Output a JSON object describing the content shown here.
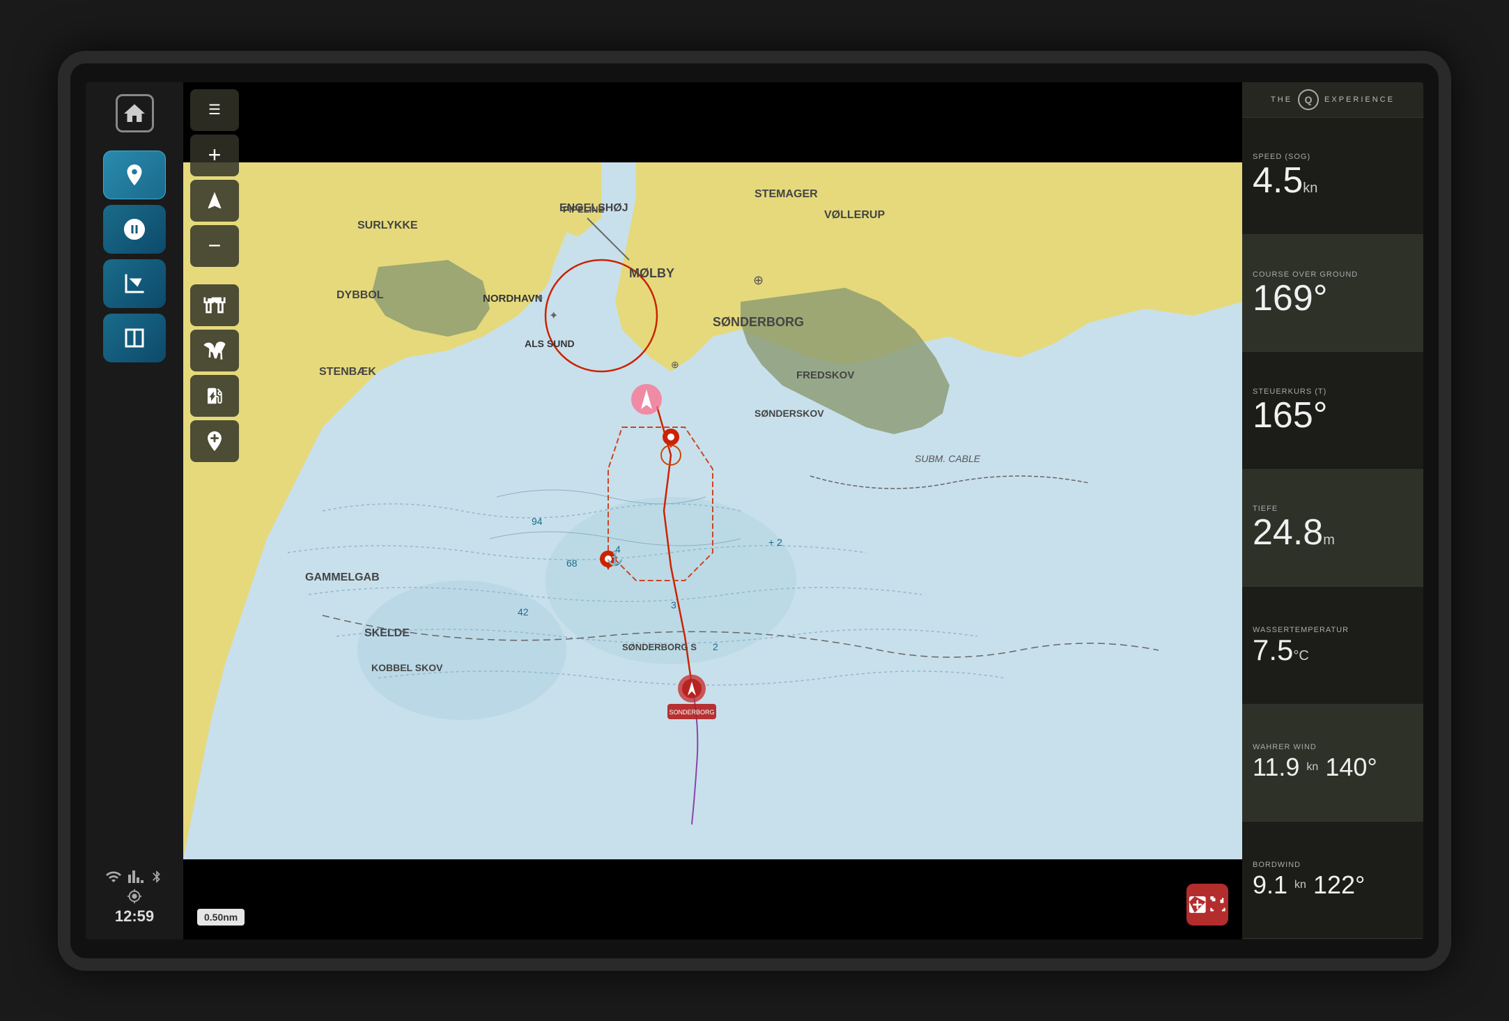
{
  "device": {
    "time": "12:59"
  },
  "sidebar": {
    "home_icon": "⌂",
    "icons": [
      {
        "name": "location",
        "active": true
      },
      {
        "name": "speed",
        "active": false
      },
      {
        "name": "chart-overlay",
        "active": false
      },
      {
        "name": "chart-dual",
        "active": false
      }
    ]
  },
  "map": {
    "toolbar": [
      {
        "label": "☰",
        "name": "menu"
      },
      {
        "label": "+",
        "name": "zoom-in"
      },
      {
        "label": "◁",
        "name": "navigate"
      },
      {
        "label": "−",
        "name": "zoom-out"
      },
      {
        "label": "⊕",
        "name": "binoculars"
      },
      {
        "label": "✿",
        "name": "bird"
      },
      {
        "label": "⛽",
        "name": "fuel"
      },
      {
        "label": "⊕",
        "name": "add-waypoint"
      }
    ],
    "scale": "0.50nm",
    "place_names": [
      "SURLYKKE",
      "ENGELSHØJ",
      "STEMAGER",
      "VØLLERUP",
      "DYBBOL",
      "NORDHAVN",
      "ALS SUND",
      "MØLBY",
      "SØNDERBORG",
      "STENBÆK",
      "FREDSKOV",
      "SØNDERSKOV",
      "GAMMELGAB",
      "SKELDE",
      "KOBBEL SKOV",
      "SØNDERBORG S",
      "SUBM. CABLE"
    ]
  },
  "instruments": {
    "brand": {
      "prefix": "THE",
      "logo": "Q",
      "suffix": "EXPERIENCE"
    },
    "speed_sog": {
      "label": "SPEED (SOG)",
      "value": "4.5",
      "unit": "kn"
    },
    "course_over_ground": {
      "label": "COURSE OVER GROUND",
      "value": "169°"
    },
    "steuerkurs": {
      "label": "STEUERKURS (T)",
      "value": "165°"
    },
    "tiefe": {
      "label": "TIEFE",
      "value": "24.8",
      "unit": "m"
    },
    "wassertemperatur": {
      "label": "WASSERTEMPERATUR",
      "value": "7.5",
      "unit": "°C"
    },
    "wahrer_wind": {
      "label": "WAHRER WIND",
      "speed": "11.9",
      "speed_unit": "kn",
      "direction": "140",
      "dir_unit": "°"
    },
    "bordwind": {
      "label": "BORDWIND",
      "speed": "9.1",
      "speed_unit": "kn",
      "direction": "122",
      "dir_unit": "°"
    }
  },
  "colors": {
    "map_water": "#d0e8f0",
    "map_shallow": "#b8d8e8",
    "map_land": "#e8d870",
    "map_land_dark": "#8a9a70",
    "brand_accent": "#4ab0d0",
    "panel_bg": "#1e1e19",
    "widget_highlight": "#32372d"
  }
}
